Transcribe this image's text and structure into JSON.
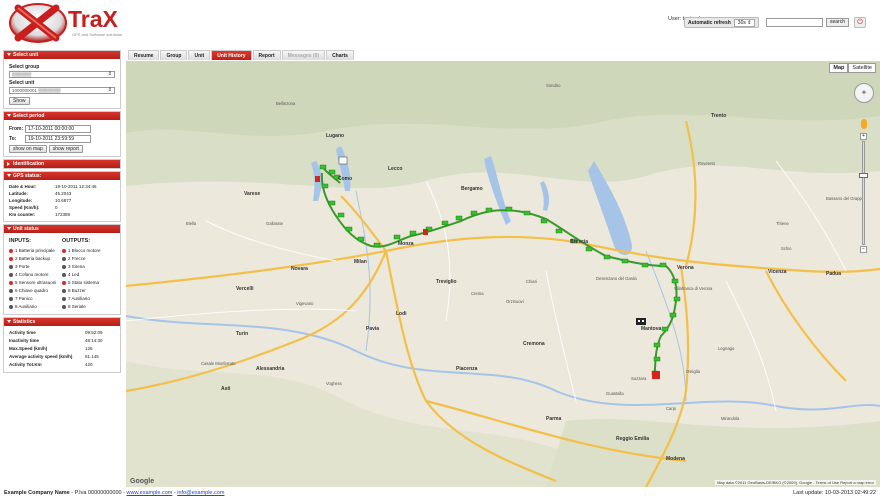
{
  "header": {
    "brand": "TraX",
    "tagline": "GPS and Software solutions",
    "user_label": "User: testweb",
    "refresh_label": "Automatic refresh",
    "refresh_value": "30s",
    "search_placeholder": "",
    "search_button": "search",
    "power_icon": "power-icon"
  },
  "sidebar": {
    "select_unit": {
      "title": "Select unit",
      "group_label": "Select group",
      "group_value": "▒▒▒▒▒▒",
      "unit_label": "Select unit",
      "unit_value": "1000000001 ▒▒▒▒▒▒▒",
      "show_button": "Show"
    },
    "select_period": {
      "title": "Select period",
      "from_label": "From:",
      "from_value": "17-10-2011 00:00:00",
      "to_label": "To:",
      "to_value": "19-10-2011 23:59:59",
      "show_map_button": "show on map",
      "show_report_button": "show report"
    },
    "identification": {
      "title": "Identification"
    },
    "gps_status": {
      "title": "GPS status:",
      "rows": [
        {
          "k": "Date & Hour:",
          "v": "19-10-2011 12:34:46"
        },
        {
          "k": "Latitude:",
          "v": "45.2043"
        },
        {
          "k": "Longitude:",
          "v": "10.6877"
        },
        {
          "k": "Speed (Km/h):",
          "v": "0"
        },
        {
          "k": "Km counter:",
          "v": "172389"
        }
      ]
    },
    "unit_status": {
      "title": "Unit status",
      "inputs_title": "INPUTS:",
      "outputs_title": "OUTPUTS:",
      "inputs": [
        {
          "label": "1 Batteria principale",
          "color": "#d62b23"
        },
        {
          "label": "2 Batteria backup",
          "color": "#d62b23"
        },
        {
          "label": "3 Porte",
          "color": "#555555"
        },
        {
          "label": "4 Cofano motore",
          "color": "#555555"
        },
        {
          "label": "5 Sensore ultrasuoni",
          "color": "#d62b23"
        },
        {
          "label": "6 Chiave quadro",
          "color": "#555555"
        },
        {
          "label": "7 Panico",
          "color": "#555555"
        },
        {
          "label": "8 Ausiliario",
          "color": "#555555"
        }
      ],
      "outputs": [
        {
          "label": "1 Blocco motore",
          "color": "#d62b23"
        },
        {
          "label": "2 Frecce",
          "color": "#555555"
        },
        {
          "label": "3 Sirena",
          "color": "#555555"
        },
        {
          "label": "4 Led",
          "color": "#555555"
        },
        {
          "label": "5 Stato sistema",
          "color": "#d62b23"
        },
        {
          "label": "6 Buzzer",
          "color": "#555555"
        },
        {
          "label": "7 Ausiliario",
          "color": "#555555"
        },
        {
          "label": "8 Seriale",
          "color": "#555555"
        }
      ]
    },
    "statistics": {
      "title": "Statistics",
      "rows": [
        {
          "k": "Activity time",
          "v": "09:52:09"
        },
        {
          "k": "Inactivity time",
          "v": "48:14:30"
        },
        {
          "k": "Max.Speed (km/h)",
          "v": "126"
        },
        {
          "k": "Average activity speed (km/h)",
          "v": "61.145"
        },
        {
          "k": "Activity Tot.Km",
          "v": "420"
        }
      ]
    }
  },
  "tabs": [
    {
      "label": "Resume",
      "state": "normal"
    },
    {
      "label": "Group",
      "state": "normal"
    },
    {
      "label": "Unit",
      "state": "normal"
    },
    {
      "label": "Unit History",
      "state": "active"
    },
    {
      "label": "Report",
      "state": "normal"
    },
    {
      "label": "Messages (0)",
      "state": "disabled"
    },
    {
      "label": "Charts",
      "state": "normal"
    }
  ],
  "map": {
    "type_map": "Map",
    "type_satellite": "Satellite",
    "google": "Google",
    "attribution": "Map data ©2011 GeoBasis-DE/BKG (©2009), Google - Terms of Use  Report a map error",
    "labels": [
      {
        "t": "Lugano",
        "big": true
      },
      {
        "t": "Como",
        "big": true
      },
      {
        "t": "Bergamo",
        "big": true
      },
      {
        "t": "Brescia",
        "big": true
      },
      {
        "t": "Verona",
        "big": true
      },
      {
        "t": "Vicenza",
        "big": true
      },
      {
        "t": "Padua",
        "big": true
      },
      {
        "t": "Trento",
        "big": true
      },
      {
        "t": "Milan",
        "big": true
      },
      {
        "t": "Novara",
        "big": true
      },
      {
        "t": "Pavia",
        "big": true
      },
      {
        "t": "Piacenza",
        "big": true
      },
      {
        "t": "Cremona",
        "big": true
      },
      {
        "t": "Mantova",
        "big": true
      },
      {
        "t": "Parma",
        "big": true
      },
      {
        "t": "Reggio Emilia",
        "big": true
      },
      {
        "t": "Modena",
        "big": true
      },
      {
        "t": "Turin",
        "big": true
      },
      {
        "t": "Vercelli",
        "big": true
      },
      {
        "t": "Alessandria",
        "big": true
      },
      {
        "t": "Asti",
        "big": true
      },
      {
        "t": "Monza",
        "big": true
      },
      {
        "t": "Varese",
        "big": true
      },
      {
        "t": "Lecco",
        "big": true
      },
      {
        "t": "Lodi",
        "big": true
      },
      {
        "t": "Treviglio",
        "big": true
      },
      {
        "t": "Rovereto",
        "big": false
      },
      {
        "t": "Bassano del Grappa",
        "big": false
      },
      {
        "t": "Villafranca di Verona",
        "big": false
      },
      {
        "t": "Legnago",
        "big": false
      },
      {
        "t": "Carpi",
        "big": false
      },
      {
        "t": "Voghera",
        "big": false
      },
      {
        "t": "Vigevano",
        "big": false
      },
      {
        "t": "Gallarate",
        "big": false
      },
      {
        "t": "Chiari",
        "big": false
      },
      {
        "t": "Desenzano del Garda",
        "big": false
      },
      {
        "t": "Sondrio",
        "big": false
      },
      {
        "t": "Bellinzona",
        "big": false
      },
      {
        "t": "Mirandola",
        "big": false
      },
      {
        "t": "Guastalla",
        "big": false
      },
      {
        "t": "Crema",
        "big": false
      },
      {
        "t": "Casale Monferrato",
        "big": false
      },
      {
        "t": "Biella",
        "big": false
      },
      {
        "t": "Schio",
        "big": false
      },
      {
        "t": "Thiene",
        "big": false
      },
      {
        "t": "Ostiglia",
        "big": false
      },
      {
        "t": "Suzzara",
        "big": false
      },
      {
        "t": "Orzinuovi",
        "big": false
      }
    ]
  },
  "footer": {
    "company": "Example Company Name",
    "details": " - P.Iva 00000000000 - ",
    "web": "www.example.com",
    "sep": " - ",
    "email": "info@example.com",
    "last_update": "Last update: 10-03-2013 02:49:22"
  }
}
